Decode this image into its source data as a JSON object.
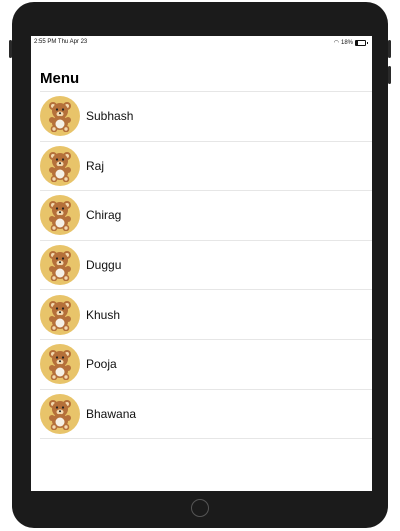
{
  "status": {
    "time": "2:55 PM   Thu Apr 23",
    "battery": "18%",
    "battery_level": 0.18
  },
  "nav": {
    "title": "Menu"
  },
  "menu": {
    "items": [
      {
        "label": "Subhash",
        "icon": "teddy-bear-icon"
      },
      {
        "label": "Raj",
        "icon": "teddy-bear-icon"
      },
      {
        "label": "Chirag",
        "icon": "teddy-bear-icon"
      },
      {
        "label": "Duggu",
        "icon": "teddy-bear-icon"
      },
      {
        "label": "Khush",
        "icon": "teddy-bear-icon"
      },
      {
        "label": "Pooja",
        "icon": "teddy-bear-icon"
      },
      {
        "label": "Bhawana",
        "icon": "teddy-bear-icon"
      }
    ]
  },
  "colors": {
    "avatar_bg": "#e8c46a",
    "bear": "#b5703a",
    "device": "#1b1b1b"
  }
}
